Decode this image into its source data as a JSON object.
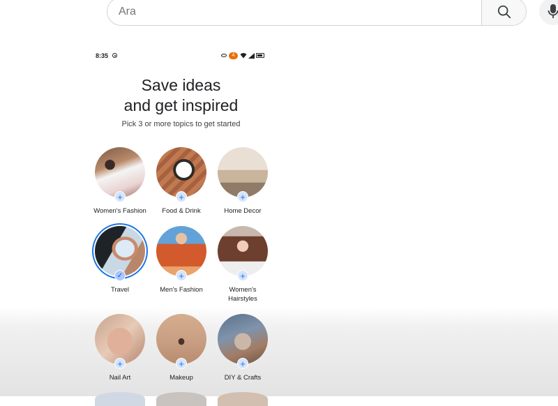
{
  "search": {
    "placeholder": "Ara",
    "value": ""
  },
  "icons": {
    "search_button": "search-icon",
    "voice_button": "microphone-icon"
  },
  "status_bar": {
    "time": "8:35",
    "notification_count": "4"
  },
  "onboarding": {
    "title_line1": "Save ideas",
    "title_line2": "and get inspired",
    "subtitle": "Pick 3 or more topics to get started"
  },
  "topics": [
    {
      "label": "Women's Fashion",
      "selected": false
    },
    {
      "label": "Food & Drink",
      "selected": false
    },
    {
      "label": "Home Decor",
      "selected": false
    },
    {
      "label": "Travel",
      "selected": true
    },
    {
      "label": "Men's Fashion",
      "selected": false
    },
    {
      "label": "Women's Hairstyles",
      "selected": false
    },
    {
      "label": "Nail Art",
      "selected": false
    },
    {
      "label": "Makeup",
      "selected": false
    },
    {
      "label": "DIY & Crafts",
      "selected": false
    }
  ],
  "badges": {
    "add_symbol": "+",
    "selected_symbol": "✓"
  },
  "colors": {
    "accent": "#1a73e8",
    "badge_bg": "#d6e4fb",
    "notification": "#e8710a"
  }
}
